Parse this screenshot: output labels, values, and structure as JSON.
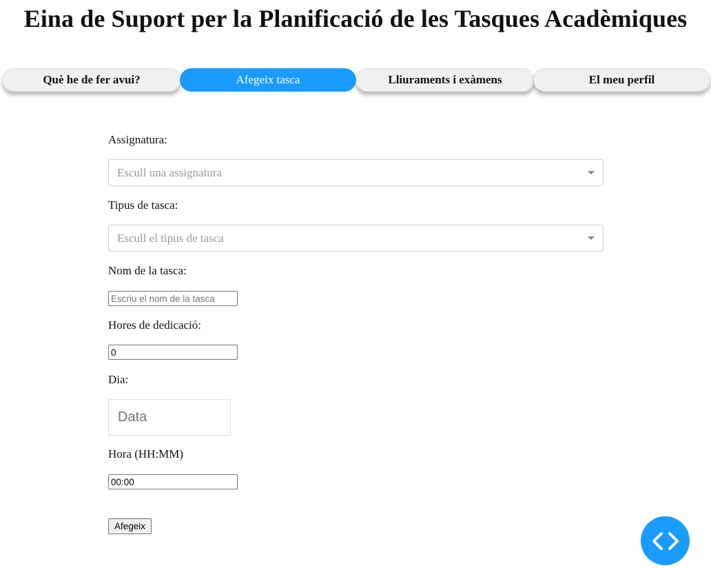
{
  "header": {
    "title": "Eina de Suport per la Planificació de les Tasques Acadèmiques"
  },
  "tabs": [
    {
      "label": "Què he de fer avui?",
      "active": false
    },
    {
      "label": "Afegeix tasca",
      "active": true
    },
    {
      "label": "Lliuraments i exàmens",
      "active": false
    },
    {
      "label": "El meu perfil",
      "active": false
    }
  ],
  "form": {
    "subject_label": "Assignatura:",
    "subject_placeholder": "Escull una assignatura",
    "type_label": "Tipus de tasca:",
    "type_placeholder": "Escull el tipus de tasca",
    "name_label": "Nom de la tasca:",
    "name_placeholder": "Escriu el nom de la tasca",
    "hours_label": "Hores de dedicació:",
    "hours_value": "0",
    "day_label": "Dia:",
    "day_placeholder": "Data",
    "time_label": "Hora (HH:MM)",
    "time_value": "00:00",
    "submit_label": "Afegeix"
  },
  "fab": {
    "icon": "code-icon",
    "color": "#1a9bff"
  },
  "colors": {
    "accent": "#1a9bff",
    "tab_background": "#f0f0f0"
  }
}
